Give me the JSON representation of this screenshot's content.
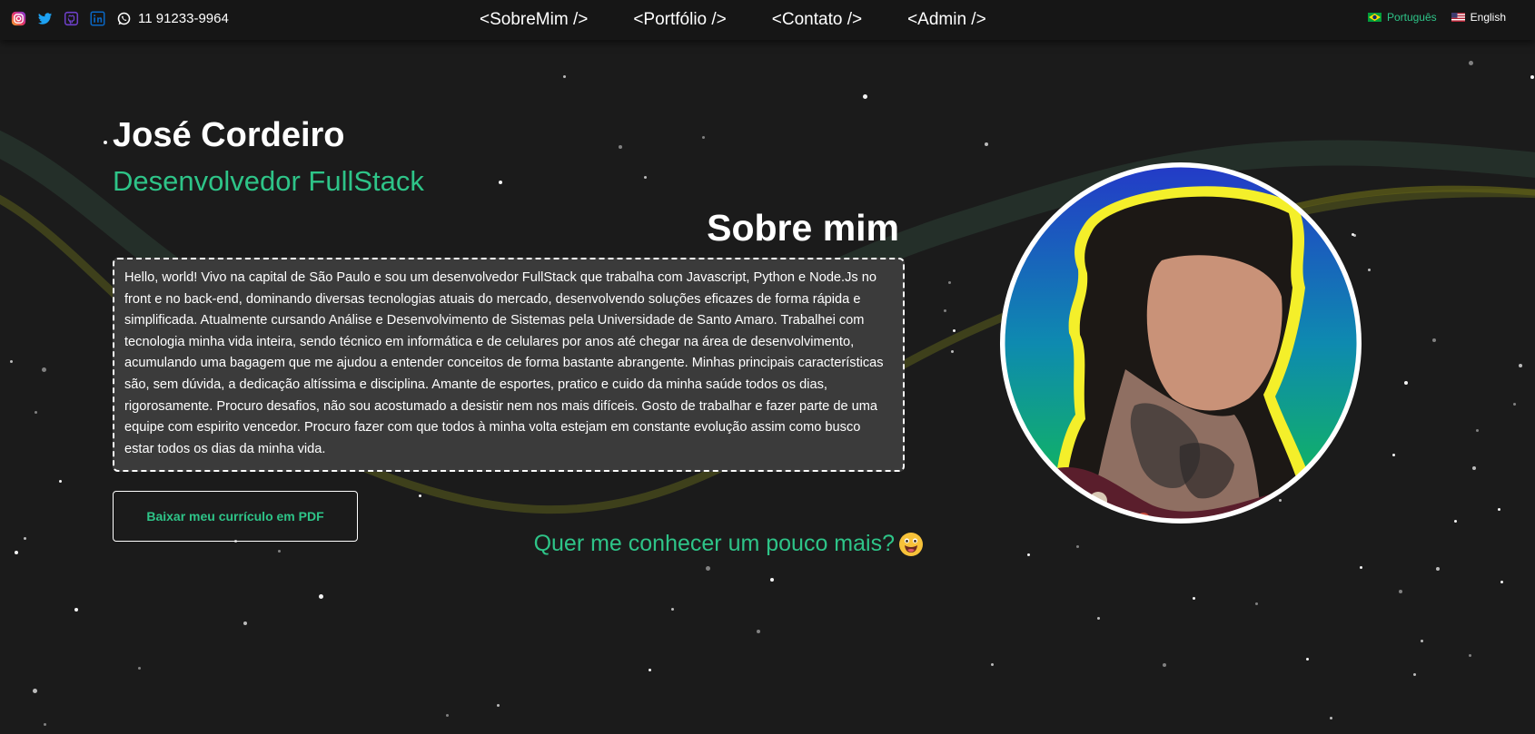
{
  "topbar": {
    "socials": [
      {
        "icon": "instagram-icon",
        "color": "#c13584"
      },
      {
        "icon": "twitter-icon",
        "color": "#1da1f2"
      },
      {
        "icon": "github-icon",
        "color": "#6e40c9"
      },
      {
        "icon": "linkedin-icon",
        "color": "#0a66c2"
      },
      {
        "icon": "whatsapp-icon",
        "color": "#ffffff"
      }
    ],
    "phone": "11 91233-9964",
    "nav": [
      "<SobreMim />",
      "<Portfólio />",
      "<Contato />",
      "<Admin />"
    ],
    "languages": [
      {
        "label": "Português",
        "flag": "brazil-flag-icon",
        "active": true
      },
      {
        "label": "English",
        "flag": "usa-flag-icon",
        "active": false
      }
    ]
  },
  "hero": {
    "name": "José Cordeiro",
    "role": "Desenvolvedor FullStack",
    "about_title": "Sobre mim",
    "about_text": "Hello, world! Vivo na capital de São Paulo e sou um desenvolvedor FullStack que trabalha com Javascript, Python e Node.Js no front e no back-end, dominando diversas tecnologias atuais do mercado, desenvolvendo soluções eficazes de forma rápida e simplificada. Atualmente cursando Análise e Desenvolvimento de Sistemas pela Universidade de Santo Amaro. Trabalhei com tecnologia minha vida inteira, sendo técnico em informática e de celulares por anos até chegar na área de desenvolvimento, acumulando uma bagagem que me ajudou a entender conceitos de forma bastante abrangente. Minhas principais características são, sem dúvida, a dedicação altíssima e disciplina. Amante de esportes, pratico e cuido da minha saúde todos os dias, rigorosamente. Procuro desafios, não sou acostumado a desistir nem nos mais difíceis. Gosto de trabalhar e fazer parte de uma equipe com espirito vencedor. Procuro fazer com que todos à minha volta estejam em constante evolução assim como busco estar todos os dias da minha vida.",
    "cv_button": "Baixar meu currículo em PDF",
    "more_link": "Quer me conhecer um pouco mais?",
    "more_emoji": "grinning-face-emoji"
  },
  "colors": {
    "accent": "#2ec488",
    "background": "#1b1b1b",
    "topbar": "#161616",
    "about_box": "#3b3b3b"
  }
}
